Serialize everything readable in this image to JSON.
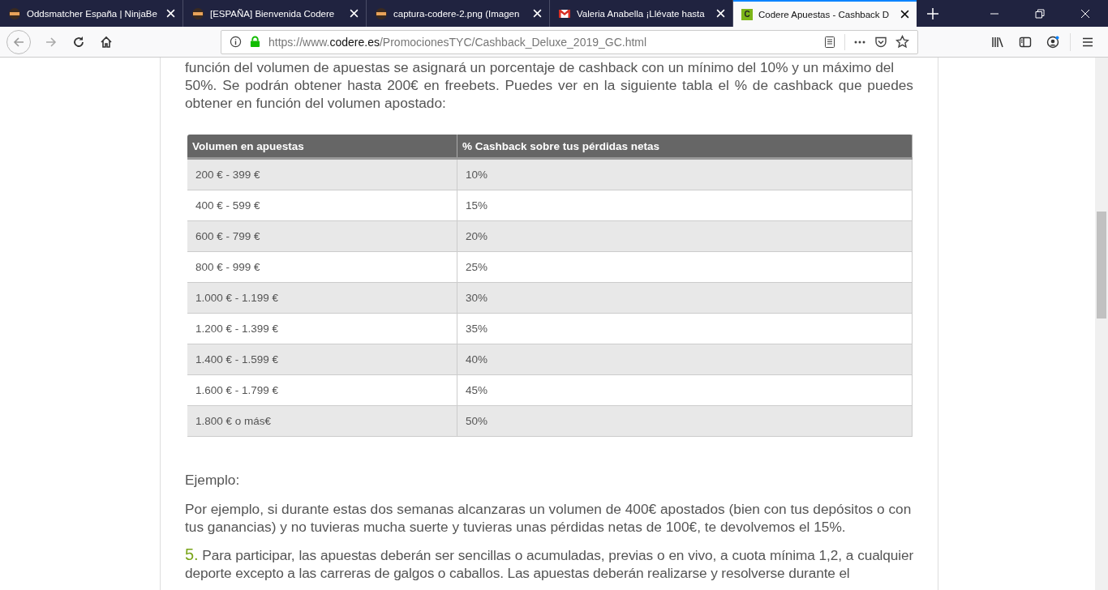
{
  "tabs": [
    {
      "title": "Oddsmatcher España | NinjaBe",
      "kind": "site",
      "selected": false
    },
    {
      "title": "[ESPAÑA] Bienvenida Codere",
      "kind": "site",
      "selected": false
    },
    {
      "title": "captura-codere-2.png (Imagen",
      "kind": "site",
      "selected": false
    },
    {
      "title": "Valeria Anabella ¡Llévate hasta",
      "kind": "mail",
      "selected": false
    },
    {
      "title": "Codere Apuestas - Cashback D",
      "kind": "brand",
      "icon_text": "C",
      "selected": true
    }
  ],
  "address": {
    "prefix": "https://www.",
    "domain": "codere.es",
    "path": "/PromocionesTYC/Cashback_Deluxe_2019_GC.html"
  },
  "intro_lines": [
    "función del volumen de apuestas se asignará un porcentaje de cashback con un mínimo del 10% y un máximo del",
    "50%. Se podrán obtener hasta 200€ en freebets. Puedes ver en la siguiente tabla el % de cashback que puedes obtener en función del volumen apostado:"
  ],
  "table": {
    "columns": [
      "Volumen en apuestas",
      "% Cashback sobre tus pérdidas netas"
    ],
    "rows": [
      [
        "200 € - 399 €",
        "10%"
      ],
      [
        "400 € - 599 €",
        "15%"
      ],
      [
        "600 € - 799 €",
        "20%"
      ],
      [
        "800 € - 999 €",
        "25%"
      ],
      [
        "1.000 € - 1.199 €",
        "30%"
      ],
      [
        "1.200 € - 1.399 €",
        "35%"
      ],
      [
        "1.400 € - 1.599 €",
        "40%"
      ],
      [
        "1.600 € - 1.799 €",
        "45%"
      ],
      [
        "1.800 € o más€",
        "50%"
      ]
    ]
  },
  "example_heading": "Ejemplo:",
  "example_text": "Por ejemplo, si durante estas dos semanas alcanzaras un volumen de 400€ apostados (bien con tus depósitos o con tus ganancias) y no tuvieras mucha suerte y tuvieras unas pérdidas netas de 100€, te devolvemos el 15%.",
  "item": {
    "number": "5.",
    "text": "Para participar, las apuestas deberán ser sencillas o acumuladas, previas o en vivo, a cuota mínima 1,2, a cualquier deporte excepto a las carreras de galgos o caballos. Las apuestas deberán realizarse y resolverse durante el"
  }
}
